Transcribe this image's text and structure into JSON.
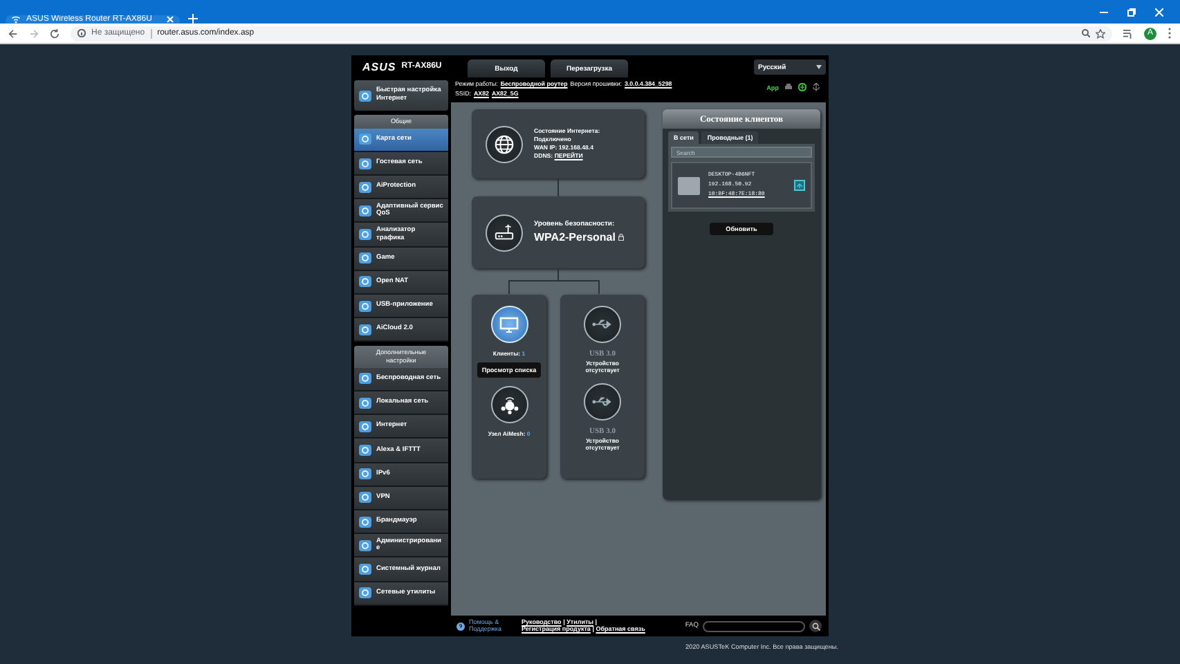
{
  "browser": {
    "tab_title": "ASUS Wireless Router RT-AX86U",
    "security_label": "Не защищено",
    "url": "router.asus.com/index.asp",
    "profile_initial": "A"
  },
  "header": {
    "logo": "ASUS",
    "model": "RT-AX86U",
    "buttons": [
      "Выход",
      "Перезагрузка"
    ],
    "language": "Русский"
  },
  "info": {
    "mode_label": "Режим работы:",
    "mode": "Беспроводной роутер",
    "firmware_label": "Версия прошивки:",
    "firmware": "3.0.0.4.384_5298",
    "ssid_label": "SSID:",
    "ssids": [
      "AX82",
      "AX82_5G"
    ],
    "app": "App"
  },
  "sidebar": {
    "quick_setup": "Быстрая настройка Интернет",
    "sections": [
      {
        "title": "Общие",
        "items": [
          {
            "label": "Карта сети",
            "selected": true
          },
          {
            "label": "Гостевая сеть",
            "selected": false
          },
          {
            "label": "AiProtection",
            "selected": false
          },
          {
            "label": "Адаптивный сервис QoS",
            "selected": false
          },
          {
            "label": "Анализатор трафика",
            "selected": false
          },
          {
            "label": "Game",
            "selected": false
          },
          {
            "label": "Open NAT",
            "selected": false
          },
          {
            "label": "USB-приложение",
            "selected": false
          },
          {
            "label": "AiCloud 2.0",
            "selected": false
          }
        ]
      },
      {
        "title": "Дополнительные настройки",
        "items": [
          {
            "label": "Беспроводная сеть",
            "selected": false
          },
          {
            "label": "Локальная сеть",
            "selected": false
          },
          {
            "label": "Интернет",
            "selected": false
          },
          {
            "label": "Alexa & IFTTT",
            "selected": false
          },
          {
            "label": "IPv6",
            "selected": false
          },
          {
            "label": "VPN",
            "selected": false
          },
          {
            "label": "Брандмауэр",
            "selected": false
          },
          {
            "label": "Администрирование",
            "selected": false
          },
          {
            "label": "Системный журнал",
            "selected": false
          },
          {
            "label": "Сетевые утилиты",
            "selected": false
          }
        ]
      }
    ]
  },
  "map": {
    "internet": {
      "status_label": "Состояние Интернета:",
      "status": "Подключено",
      "wan_label": "WAN IP:",
      "wan_ip": "192.168.48.4",
      "ddns_label": "DDNS:",
      "ddns_link": "ПЕРЕЙТИ"
    },
    "security": {
      "label": "Уровень безопасности:",
      "value": "WPA2-Personal"
    },
    "clients": {
      "label": "Клиенты:",
      "count": "1",
      "button": "Просмотр списка"
    },
    "aimesh": {
      "label": "Узел AiMesh:",
      "count": "0"
    },
    "usb": [
      {
        "port": "USB 3.0",
        "status": "Устройство отсутствует"
      },
      {
        "port": "USB 3.0",
        "status": "Устройство отсутствует"
      }
    ]
  },
  "clients_panel": {
    "title": "Состояние клиентов",
    "tabs": [
      {
        "label": "В сети",
        "selected": true
      },
      {
        "label": "Проводные (1)",
        "selected": false
      }
    ],
    "search": {
      "placeholder": "Search"
    },
    "clients": [
      {
        "name": "DESKTOP-4B6NFT",
        "ip": "192.168.50.92",
        "mac": "10:BF:48:7E:18:80"
      }
    ],
    "refresh_button": "Обновить"
  },
  "footer": {
    "help": "Помощь & Поддержка",
    "links": [
      "Руководство",
      "Утилиты",
      "Регистрация продукта",
      "Обратная связь"
    ],
    "separator": "|",
    "faq": "FAQ"
  },
  "copyright": "2020 ASUSTeK Computer Inc. Все права защищены."
}
